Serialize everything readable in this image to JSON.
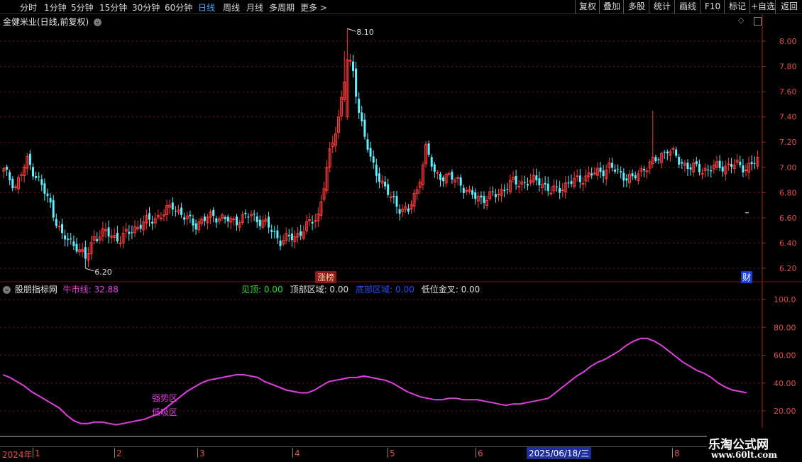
{
  "topbar": {
    "tabs": [
      {
        "label": "分时",
        "active": false
      },
      {
        "label": "1分钟",
        "active": false
      },
      {
        "label": "5分钟",
        "active": false
      },
      {
        "label": "15分钟",
        "active": false
      },
      {
        "label": "30分钟",
        "active": false
      },
      {
        "label": "60分钟",
        "active": false
      },
      {
        "label": "日线",
        "active": true
      },
      {
        "label": "周线",
        "active": false
      },
      {
        "label": "月线",
        "active": false
      },
      {
        "label": "多周期",
        "active": false
      },
      {
        "label": "更多 >",
        "active": false
      }
    ],
    "right_buttons": [
      "复权",
      "叠加",
      "多股",
      "统计",
      "画线",
      "F10",
      "标记",
      "+自选",
      "返回"
    ]
  },
  "main_chart": {
    "title": "金健米业(日线,前复权)",
    "high_label": "8.10",
    "low_label": "6.20",
    "event_tag": "涨榜",
    "finance_tag": "财",
    "y_ticks": [
      "8.00",
      "7.80",
      "7.60",
      "7.40",
      "7.20",
      "7.00",
      "6.80",
      "6.60",
      "6.40",
      "6.20"
    ],
    "colors": {
      "up": "#ff3b3b",
      "down": "#5ff0ff",
      "grid": "#6a1a1a",
      "axis": "#a52a2a",
      "tick_text": "#e05050"
    }
  },
  "indicator": {
    "name": "股朋指标网",
    "bull_line_label": "牛市线: 32.88",
    "legend": [
      {
        "text": "见顶: 0.00",
        "color": "#33dd33"
      },
      {
        "text": "顶部区域: 0.00",
        "color": "#dddddd"
      },
      {
        "text": "底部区域: 0.00",
        "color": "#2a4dff"
      },
      {
        "text": "低位金叉: 0.00",
        "color": "#dddddd"
      }
    ],
    "zone_upper": "强势区",
    "zone_lower": "低吸区",
    "y_ticks": [
      "100.0",
      "80.00",
      "60.00",
      "40.00",
      "20.00"
    ],
    "line_color": "#e23de2",
    "series": [
      46,
      44,
      41,
      38,
      34,
      31,
      28,
      25,
      22,
      17,
      13,
      11,
      11,
      12,
      12,
      11,
      10,
      11,
      12,
      13,
      14,
      16,
      18,
      22,
      26,
      30,
      34,
      37,
      40,
      42,
      43,
      44,
      45,
      46,
      46,
      45,
      44,
      41,
      39,
      37,
      35,
      34,
      33,
      33,
      35,
      38,
      41,
      42,
      43,
      44,
      44,
      45,
      44,
      43,
      42,
      40,
      37,
      34,
      32,
      30,
      29,
      28,
      28,
      29,
      29,
      28,
      28,
      28,
      27,
      26,
      25,
      24,
      25,
      25,
      26,
      27,
      28,
      29,
      33,
      37,
      41,
      45,
      48,
      52,
      55,
      57,
      60,
      63,
      67,
      70,
      72,
      72,
      70,
      67,
      63,
      59,
      55,
      52,
      49,
      47,
      44,
      40,
      37,
      35,
      34,
      33
    ]
  },
  "time_axis": {
    "year_label": "2024年",
    "months": [
      "1",
      "2",
      "3",
      "4",
      "5",
      "6",
      "8"
    ],
    "cursor_date": "2025/06/18/三"
  },
  "watermark": {
    "name": "乐淘公式网",
    "url": "www.60lt.com"
  }
}
